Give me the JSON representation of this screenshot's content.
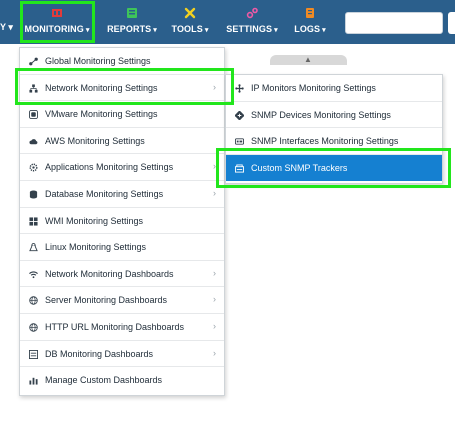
{
  "nav": {
    "edge_fragment": "Y ▾",
    "items": [
      {
        "label": "MONITORING",
        "icon": "monitoring-icon",
        "color": "#e23b3b"
      },
      {
        "label": "REPORTS",
        "icon": "reports-icon",
        "color": "#3ec45a"
      },
      {
        "label": "TOOLS",
        "icon": "tools-icon",
        "color": "#f2d021"
      },
      {
        "label": "SETTINGS",
        "icon": "settings-icon",
        "color": "#ee5aa6"
      },
      {
        "label": "LOGS",
        "icon": "logs-icon",
        "color": "#f08a24"
      }
    ],
    "search_value": ""
  },
  "monitoring_menu": {
    "items": [
      {
        "label": "Global Monitoring Settings",
        "icon": "share-nodes-icon",
        "submenu": false
      },
      {
        "label": "Network Monitoring Settings",
        "icon": "network-icon",
        "submenu": true
      },
      {
        "label": "VMware Monitoring Settings",
        "icon": "vmware-icon",
        "submenu": false
      },
      {
        "label": "AWS Monitoring Settings",
        "icon": "cloud-icon",
        "submenu": false
      },
      {
        "label": "Applications Monitoring Settings",
        "icon": "applications-gear-icon",
        "submenu": true
      },
      {
        "label": "Database Monitoring Settings",
        "icon": "database-icon",
        "submenu": true
      },
      {
        "label": "WMI Monitoring Settings",
        "icon": "windows-icon",
        "submenu": false
      },
      {
        "label": "Linux Monitoring Settings",
        "icon": "linux-icon",
        "submenu": false
      },
      {
        "label": "Network Monitoring Dashboards",
        "icon": "wifi-icon",
        "submenu": true
      },
      {
        "label": "Server Monitoring Dashboards",
        "icon": "globe-icon",
        "submenu": true
      },
      {
        "label": "HTTP URL Monitoring Dashboards",
        "icon": "globe-icon",
        "submenu": true
      },
      {
        "label": "DB Monitoring Dashboards",
        "icon": "list-icon",
        "submenu": true
      },
      {
        "label": "Manage Custom Dashboards",
        "icon": "bar-chart-icon",
        "submenu": false
      }
    ]
  },
  "network_submenu": {
    "items": [
      {
        "label": "IP Monitors Monitoring Settings",
        "icon": "ip-network-icon"
      },
      {
        "label": "SNMP Devices Monitoring Settings",
        "icon": "snmp-device-icon"
      },
      {
        "label": "SNMP Interfaces Monitoring Settings",
        "icon": "interface-card-icon"
      },
      {
        "label": "Custom SNMP Trackers",
        "icon": "tracker-icon"
      }
    ]
  },
  "colors": {
    "navbar": "#2b5f8c",
    "highlight": "#22e61c",
    "selected": "#1580d1"
  }
}
